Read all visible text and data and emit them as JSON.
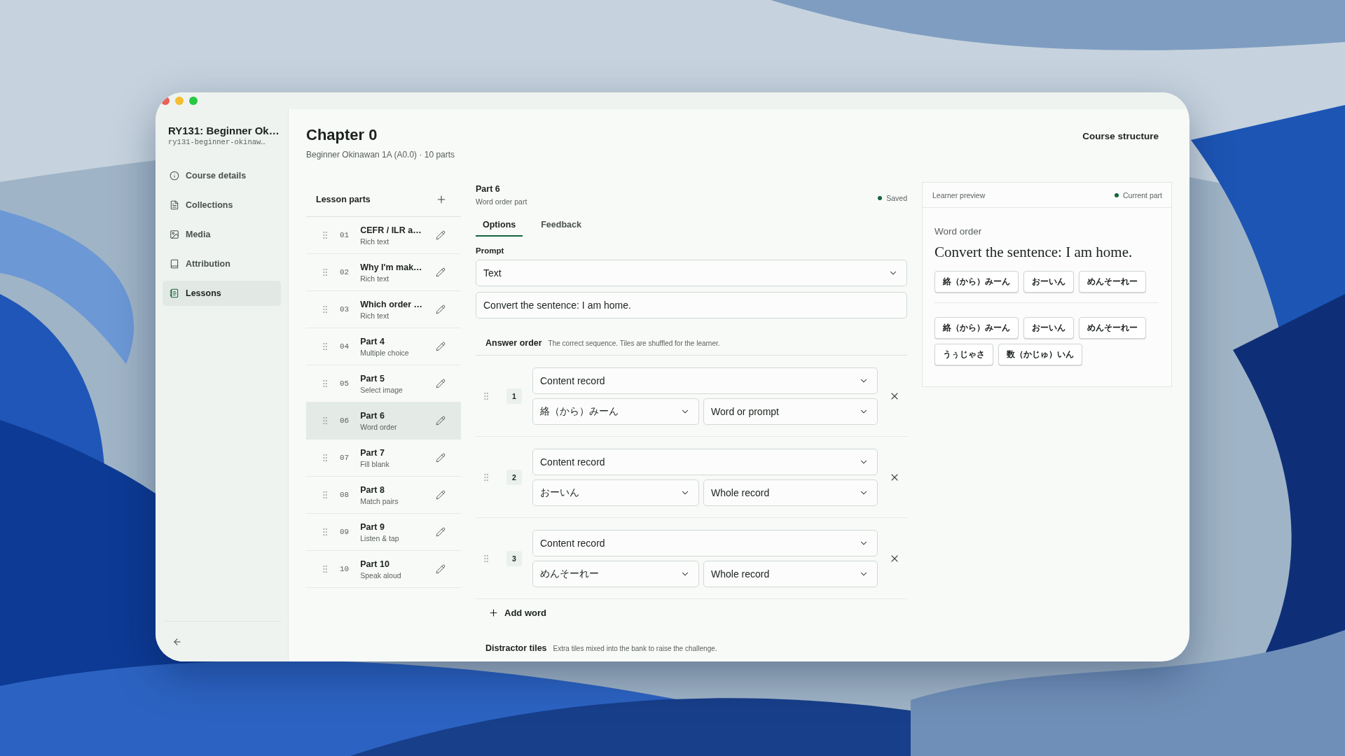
{
  "sidebar": {
    "course_title": "RY131: Beginner Ok…",
    "course_slug": "ry131-beginner-okinaw…",
    "items": [
      {
        "label": "Course details",
        "selected": false
      },
      {
        "label": "Collections",
        "selected": false
      },
      {
        "label": "Media",
        "selected": false
      },
      {
        "label": "Attribution",
        "selected": false
      },
      {
        "label": "Lessons",
        "selected": true
      }
    ]
  },
  "header": {
    "title": "Chapter 0",
    "subtitle": "Beginner Okinawan 1A (A0.0) · 10 parts",
    "link": "Course structure"
  },
  "lesson_parts": {
    "title": "Lesson parts",
    "items": [
      {
        "number": "01",
        "title": "CEFR / ILR a…",
        "type": "Rich text",
        "selected": false
      },
      {
        "number": "02",
        "title": "Why I'm mak…",
        "type": "Rich text",
        "selected": false
      },
      {
        "number": "03",
        "title": "Which order …",
        "type": "Rich text",
        "selected": false
      },
      {
        "number": "04",
        "title": "Part 4",
        "type": "Multiple choice",
        "selected": false
      },
      {
        "number": "05",
        "title": "Part 5",
        "type": "Select image",
        "selected": false
      },
      {
        "number": "06",
        "title": "Part 6",
        "type": "Word order",
        "selected": true
      },
      {
        "number": "07",
        "title": "Part 7",
        "type": "Fill blank",
        "selected": false
      },
      {
        "number": "08",
        "title": "Part 8",
        "type": "Match pairs",
        "selected": false
      },
      {
        "number": "09",
        "title": "Part 9",
        "type": "Listen & tap",
        "selected": false
      },
      {
        "number": "10",
        "title": "Part 10",
        "type": "Speak aloud",
        "selected": false
      }
    ]
  },
  "editor": {
    "title": "Part 6",
    "subtitle": "Word order part",
    "status": "Saved",
    "tabs": [
      {
        "label": "Options",
        "selected": true
      },
      {
        "label": "Feedback",
        "selected": false
      }
    ],
    "prompt_label": "Prompt",
    "prompt_type": "Text",
    "prompt_text": "Convert the sentence: I am home.",
    "answer_order": {
      "title": "Answer order",
      "hint": "The correct sequence. Tiles are shuffled for the learner.",
      "rows": [
        {
          "number": "1",
          "source": "Content record",
          "record": "絡（から）みーん",
          "field": "Word or prompt"
        },
        {
          "number": "2",
          "source": "Content record",
          "record": "おーいん",
          "field": "Whole record"
        },
        {
          "number": "3",
          "source": "Content record",
          "record": "めんそーれー",
          "field": "Whole record"
        }
      ],
      "add_button": "Add word"
    },
    "distractors": {
      "title": "Distractor tiles",
      "hint": "Extra tiles mixed into the bank to raise the challenge."
    }
  },
  "preview": {
    "title": "Learner preview",
    "status": "Current part",
    "kind_label": "Word order",
    "sentence": "Convert the sentence: I am home.",
    "answer_tiles": [
      "絡（から）みーん",
      "おーいん",
      "めんそーれー"
    ],
    "bank_tiles": [
      "絡（から）みーん",
      "おーいん",
      "めんそーれー",
      "うぅじゃさ",
      "数（かじゅ）いん"
    ]
  }
}
